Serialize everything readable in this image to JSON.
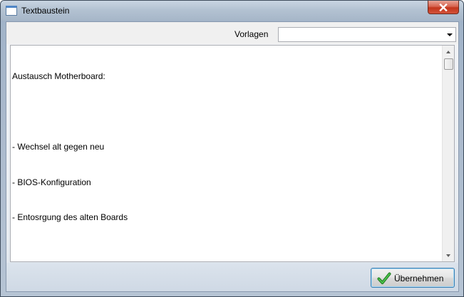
{
  "window": {
    "title": "Textbaustein"
  },
  "template_selector": {
    "label": "Vorlagen",
    "selected_value": ""
  },
  "text_editor": {
    "lines": [
      "Austausch Motherboard:",
      "",
      "- Wechsel alt gegen neu",
      "- BIOS-Konfiguration",
      "- Entosrgung des alten Boards"
    ]
  },
  "footer": {
    "apply_label": "Übernehmen"
  },
  "icons": {
    "window_icon": "window-icon",
    "close": "close-icon",
    "apply": "checkmark-icon"
  },
  "colors": {
    "close_button": "#c2351c",
    "checkmark": "#2e9a2e",
    "button_focus_border": "#3c7fb1"
  }
}
